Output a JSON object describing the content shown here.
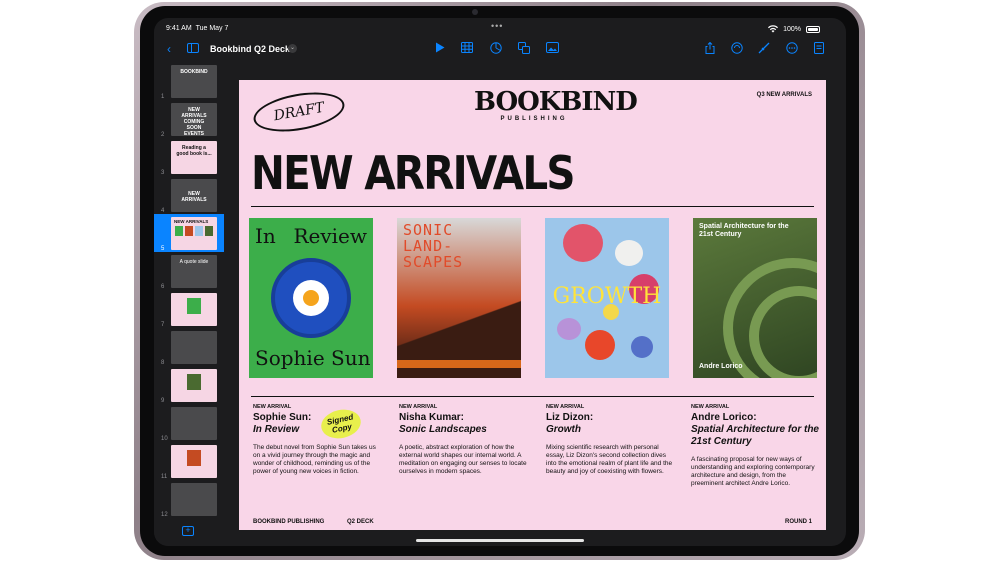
{
  "status_bar": {
    "time": "9:41 AM",
    "date": "Tue May 7",
    "battery": "100%"
  },
  "toolbar": {
    "document_title": "Bookbind Q2 Deck",
    "icons": [
      "back-chevron-icon",
      "sidebar-toggle-icon",
      "play-icon",
      "table-icon",
      "chart-icon",
      "shapes-icon",
      "media-icon",
      "share-icon",
      "collaborate-icon",
      "format-brush-icon",
      "more-icon",
      "document-icon"
    ]
  },
  "sidebar": {
    "slides": [
      {
        "number": "1",
        "label": "BOOKBIND",
        "style": "dark"
      },
      {
        "number": "2",
        "label": "NEW ARRIVALS COMING SOON EVENTS",
        "style": "dark"
      },
      {
        "number": "3",
        "label": "Reading a good book is...",
        "style": "pink"
      },
      {
        "number": "4",
        "label": "NEW ARRIVALS",
        "style": "dark"
      },
      {
        "number": "5",
        "label": "NEW ARRIVALS",
        "style": "pink"
      },
      {
        "number": "6",
        "label": "A quote slide",
        "style": "dark"
      },
      {
        "number": "7",
        "label": "",
        "style": "pink"
      },
      {
        "number": "8",
        "label": "",
        "style": "dark"
      },
      {
        "number": "9",
        "label": "",
        "style": "pink"
      },
      {
        "number": "10",
        "label": "",
        "style": "dark"
      },
      {
        "number": "11",
        "label": "",
        "style": "pink"
      },
      {
        "number": "12",
        "label": "",
        "style": "dark"
      }
    ],
    "selected_index": 4
  },
  "slide": {
    "draft_stamp": "DRAFT",
    "logo_main": "BOOKBIND",
    "logo_sub": "PUBLISHING",
    "corner_label": "Q3 NEW ARRIVALS",
    "headline": "NEW ARRIVALS",
    "covers": {
      "cover1_top_left": "In",
      "cover1_top_right": "Review",
      "cover1_bottom": "Sophie Sun",
      "cover2_title": "SONIC LAND- SCAPES",
      "cover3_title": "GROWTH",
      "cover4_title": "Spatial Architecture for the 21st Century",
      "cover4_author": "Andre Lorico"
    },
    "signed_sticker": "Signed Copy",
    "books": [
      {
        "tag": "NEW ARRIVAL",
        "name": "Sophie Sun:",
        "title": "In Review",
        "description": "The debut novel from Sophie Sun takes us on a vivid journey through the magic and wonder of childhood, reminding us of the power of young new voices in fiction."
      },
      {
        "tag": "NEW ARRIVAL",
        "name": "Nisha Kumar:",
        "title": "Sonic Landscapes",
        "description": "A poetic, abstract exploration of how the external world shapes our internal world. A meditation on engaging our senses to locate ourselves in modern spaces."
      },
      {
        "tag": "NEW ARRIVAL",
        "name": "Liz Dizon:",
        "title": "Growth",
        "description": "Mixing scientific research with personal essay, Liz Dizon's second collection dives into the emotional realm of plant life and the beauty and joy of coexisting with flowers."
      },
      {
        "tag": "NEW ARRIVAL",
        "name": "Andre Lorico:",
        "title": "Spatial Architecture for the 21st Century",
        "description": "A fascinating proposal for new ways of understanding and exploring contemporary architecture and design, from the preeminent architect Andre Lorico."
      }
    ],
    "footer_left": "BOOKBIND PUBLISHING",
    "footer_mid": "Q2 DECK",
    "footer_right": "ROUND 1"
  }
}
